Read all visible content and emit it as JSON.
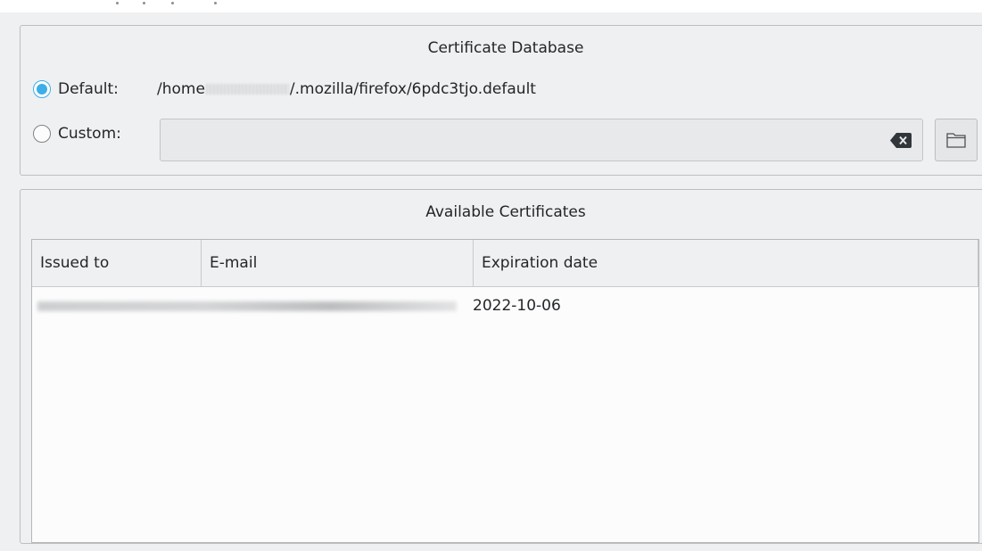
{
  "certificate_database": {
    "title": "Certificate Database",
    "default_label": "Default:",
    "default_path_prefix": "/home",
    "default_path_suffix": "/.mozilla/firefox/6pdc3tjo.default",
    "custom_label": "Custom:",
    "custom_value": "",
    "selected": "default"
  },
  "available_certificates": {
    "title": "Available Certificates",
    "columns": [
      "Issued to",
      "E-mail",
      "Expiration date"
    ],
    "rows": [
      {
        "issued_to": "",
        "email": "",
        "expiration_date": "2022-10-06"
      }
    ]
  },
  "icons": {
    "clear": "backspace-clear-icon",
    "folder": "folder-open-icon"
  },
  "colors": {
    "accent": "#3daee9",
    "window_bg": "#eff0f1",
    "text": "#232629"
  }
}
